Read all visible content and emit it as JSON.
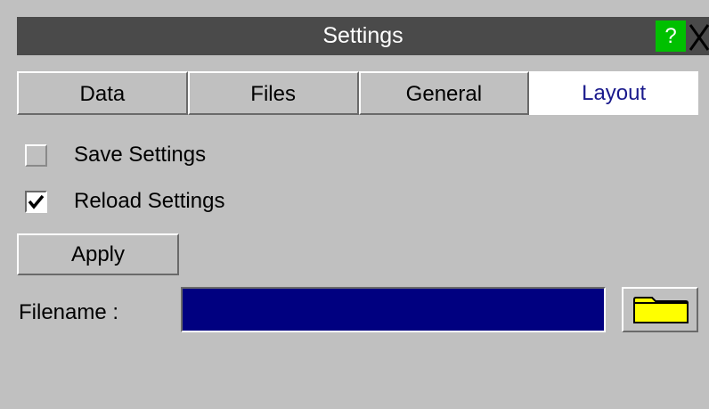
{
  "window": {
    "title": "Settings",
    "help_label": "?",
    "close_icon": "close-icon"
  },
  "tabs": [
    {
      "label": "Data",
      "active": false
    },
    {
      "label": "Files",
      "active": false
    },
    {
      "label": "General",
      "active": false
    },
    {
      "label": "Layout",
      "active": true
    }
  ],
  "options": {
    "save_settings": {
      "label": "Save Settings",
      "checked": false
    },
    "reload_settings": {
      "label": "Reload Settings",
      "checked": true
    }
  },
  "apply_label": "Apply",
  "filename": {
    "label": "Filename :",
    "value": "",
    "browse_icon": "folder-icon"
  },
  "colors": {
    "titlebar": "#4a4a4a",
    "help_button": "#00c000",
    "active_tab_text": "#1a1a8c",
    "filename_field": "#000080",
    "folder_icon": "#ffff00"
  }
}
